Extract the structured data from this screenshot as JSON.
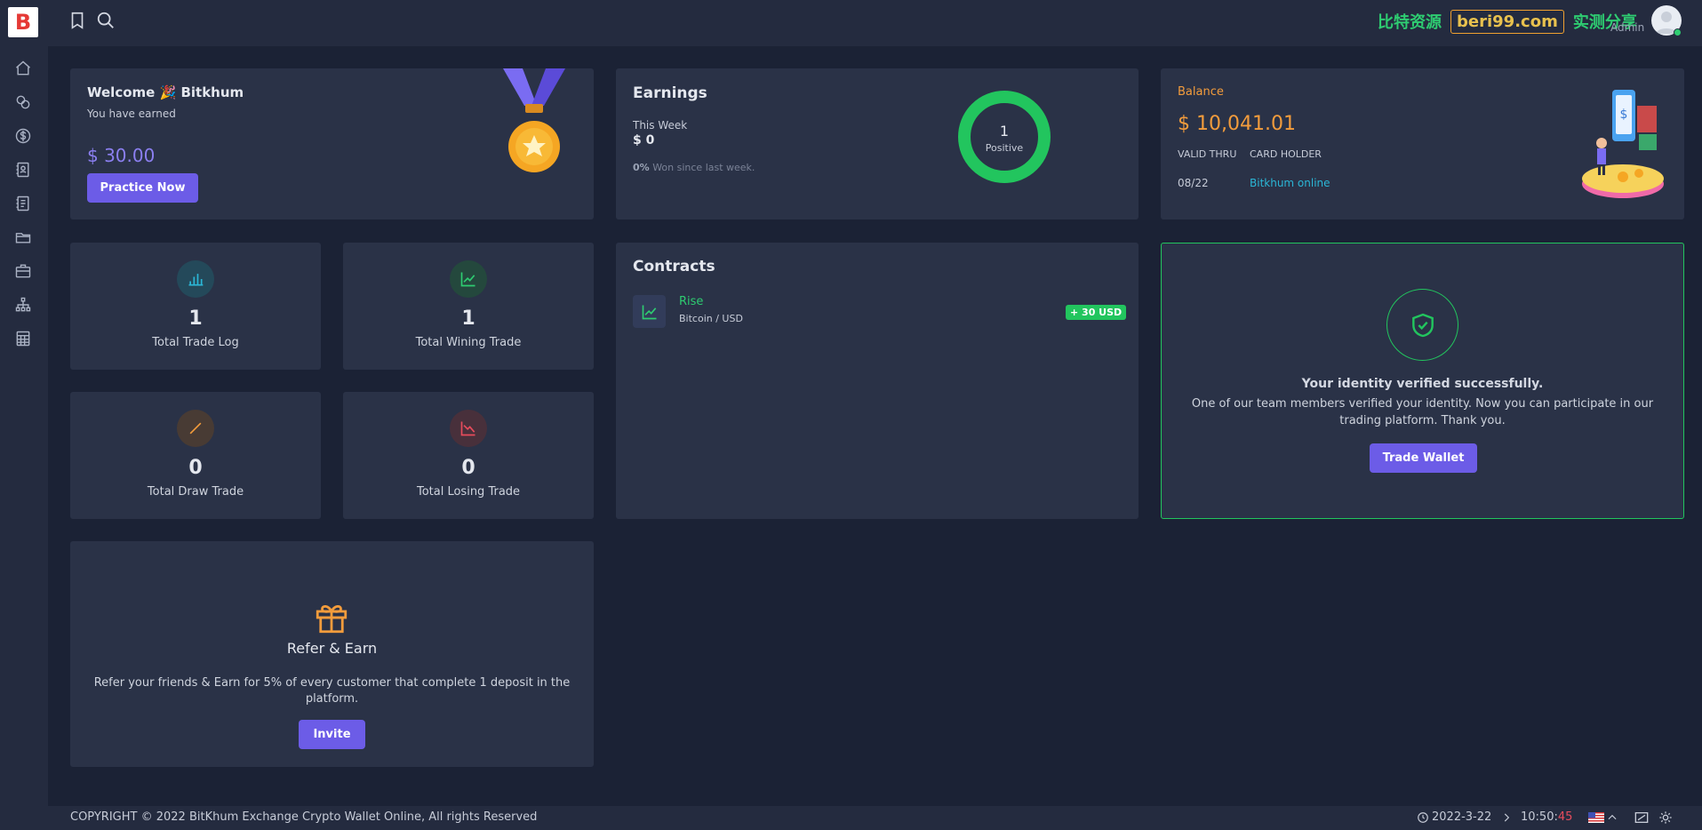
{
  "brand": {
    "logo_letter": "B"
  },
  "sidebar": {
    "items": [
      {
        "icon": "home-icon"
      },
      {
        "icon": "coins-icon"
      },
      {
        "icon": "dollar-circle-icon"
      },
      {
        "icon": "contacts-book-icon"
      },
      {
        "icon": "notebook-icon"
      },
      {
        "icon": "folder-icon"
      },
      {
        "icon": "briefcase-icon"
      },
      {
        "icon": "sitemap-icon"
      },
      {
        "icon": "calculator-icon"
      }
    ]
  },
  "topbar": {
    "watermark_left": "比特资源",
    "watermark_box": "beri99.com",
    "watermark_right": "实测分享",
    "user_role": "Admin"
  },
  "welcome": {
    "greeting": "Welcome 🎉 Bitkhum",
    "subtitle": "You have earned",
    "amount": "$ 30.00",
    "button": "Practice Now"
  },
  "earnings": {
    "title": "Earnings",
    "period": "This Week",
    "value": "$ 0",
    "pct": "0%",
    "since": "Won since last week.",
    "donut_value": "1",
    "donut_label": "Positive",
    "donut_fraction": 1.0
  },
  "balance": {
    "title": "Balance",
    "amount": "$ 10,041.01",
    "valid_thru_label": "VALID THRU",
    "card_holder_label": "CARD HOLDER",
    "valid_thru": "08/22",
    "card_holder": "Bitkhum online"
  },
  "stats": [
    {
      "value": "1",
      "label": "Total Trade Log",
      "icon": "bar-chart-icon",
      "color": "#2bb6d6"
    },
    {
      "value": "1",
      "label": "Total Wining Trade",
      "icon": "trend-up-icon",
      "color": "#2ecc71"
    },
    {
      "value": "0",
      "label": "Total Draw Trade",
      "icon": "slash-icon",
      "color": "#f39c3c"
    },
    {
      "value": "0",
      "label": "Total Losing Trade",
      "icon": "trend-down-icon",
      "color": "#e74c5c"
    }
  ],
  "contracts": {
    "title": "Contracts",
    "items": [
      {
        "type": "Rise",
        "pair": "Bitcoin / USD",
        "badge": "+ 30 USD"
      }
    ]
  },
  "identity": {
    "title": "Your identity verified successfully.",
    "line1": "One of our team members verified your identity. Now you can participate in our",
    "line2": "trading platform. Thank you.",
    "button": "Trade Wallet"
  },
  "refer": {
    "title": "Refer & Earn",
    "line1": "Refer your friends & Earn for 5% of every customer that complete 1 deposit in the",
    "line2": "platform.",
    "button": "Invite"
  },
  "footer": {
    "copyright": "COPYRIGHT © 2022 BitKhum Exchange Crypto Wallet Online, All rights Reserved",
    "date": "2022-3-22",
    "time_hm": "10:50:",
    "time_s": "45"
  },
  "colors": {
    "accent": "#6c5ce7",
    "success": "#2ecc71",
    "warning": "#f39c3c",
    "info": "#2bb6d6",
    "danger": "#e74c5c"
  }
}
